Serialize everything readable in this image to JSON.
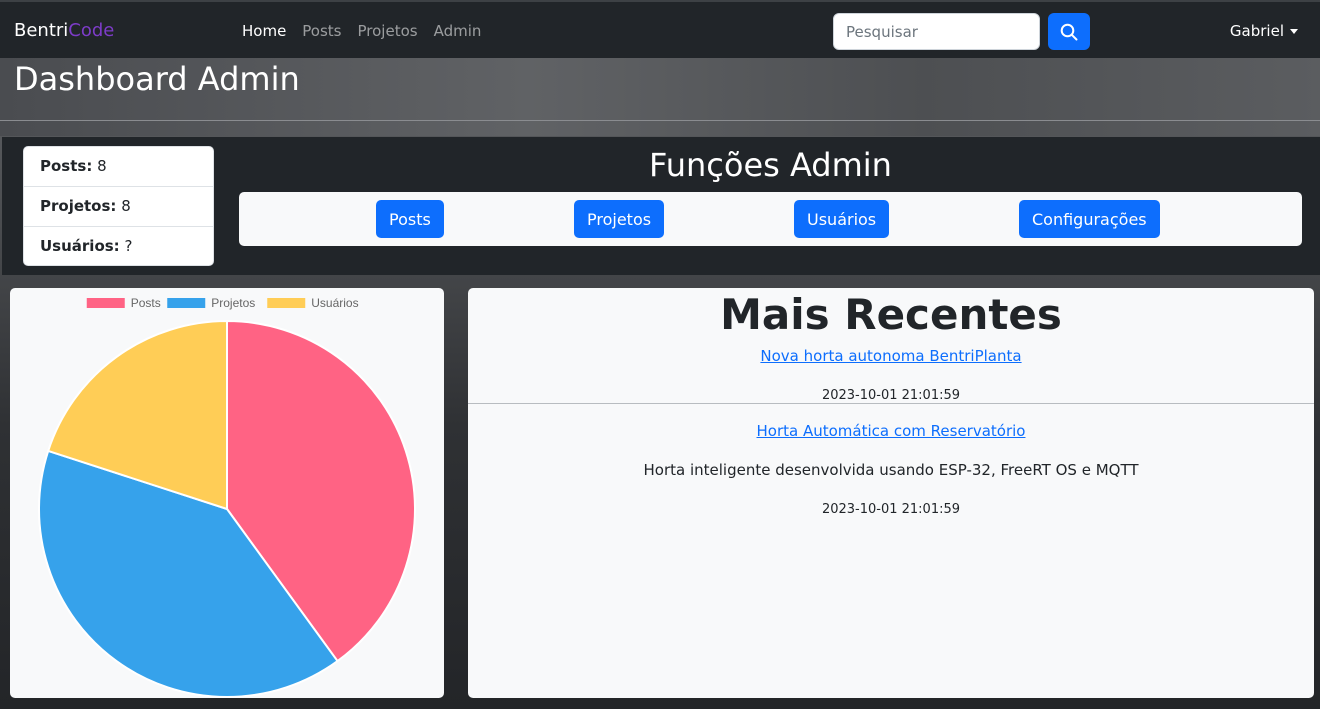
{
  "navbar": {
    "brand_part1": "Bentri",
    "brand_part2": "Code",
    "links": [
      "Home",
      "Posts",
      "Projetos",
      "Admin"
    ],
    "search_placeholder": "Pesquisar",
    "user": "Gabriel"
  },
  "header": {
    "title": "Dashboard Admin"
  },
  "stats": {
    "posts_label": "Posts:",
    "posts_value": " 8",
    "projects_label": "Projetos:",
    "projects_value": " 8",
    "users_label": "Usuários:",
    "users_value": " ?"
  },
  "functions": {
    "title": "Funções Admin",
    "buttons": [
      "Posts",
      "Projetos",
      "Usuários",
      "Configurações"
    ]
  },
  "chart_data": {
    "type": "pie",
    "categories": [
      "Posts",
      "Projetos",
      "Usuários"
    ],
    "values": [
      8,
      8,
      4
    ],
    "colors": [
      "#ff6384",
      "#36a2eb",
      "#ffcd56"
    ],
    "legend_position": "top"
  },
  "recent": {
    "title": "Mais Recentes",
    "posts": [
      {
        "title": "Nova horta autonoma BentriPlanta",
        "description": "",
        "date": "2023-10-01 21:01:59"
      },
      {
        "title": "Horta Automática com Reservatório",
        "description": "Horta inteligente desenvolvida usando ESP-32, FreeRT OS e MQTT",
        "date": "2023-10-01 21:01:59"
      }
    ]
  },
  "icons": {
    "search": "search-icon",
    "caret": "chevron-down-icon"
  },
  "colors": {
    "primary": "#0d6efd",
    "navbar": "#212529",
    "brand_accent": "#7d3cc8"
  }
}
